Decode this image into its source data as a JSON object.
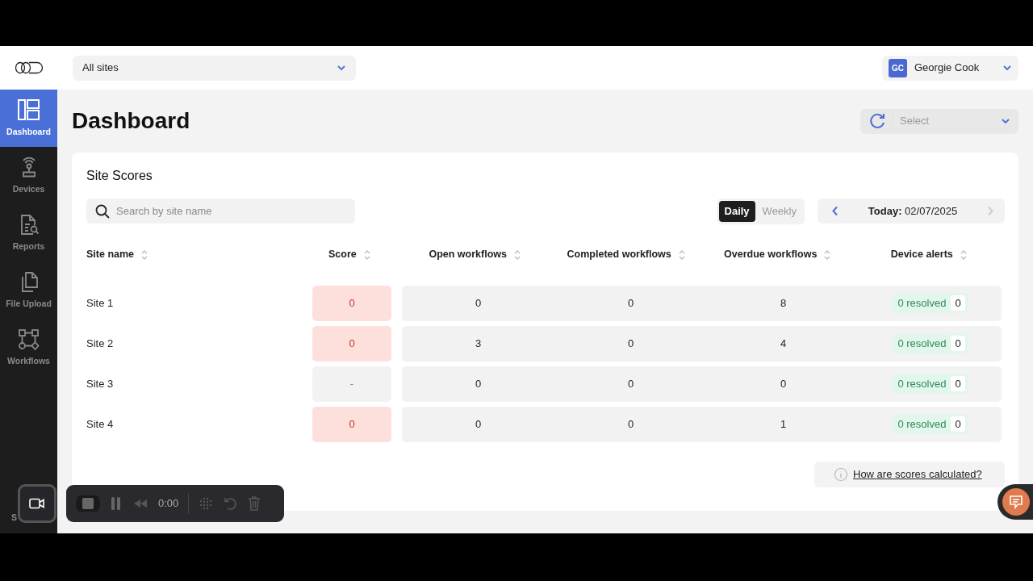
{
  "header": {
    "site_filter": "All sites",
    "user": {
      "initials": "GC",
      "name": "Georgie Cook"
    }
  },
  "sidebar": {
    "items": [
      {
        "label": "Dashboard",
        "selected": true
      },
      {
        "label": "Devices",
        "selected": false
      },
      {
        "label": "Reports",
        "selected": false
      },
      {
        "label": "File Upload",
        "selected": false
      },
      {
        "label": "Workflows",
        "selected": false
      }
    ],
    "partial_label": "S"
  },
  "page": {
    "title": "Dashboard",
    "select": {
      "placeholder": "Select"
    }
  },
  "site_scores": {
    "title": "Site Scores",
    "search": {
      "placeholder": "Search by site name"
    },
    "period_tabs": [
      {
        "label": "Daily",
        "selected": true
      },
      {
        "label": "Weekly",
        "selected": false
      }
    ],
    "date": {
      "prefix": "Today:",
      "value": "02/07/2025"
    },
    "columns": [
      "Site name",
      "Score",
      "Open workflows",
      "Completed workflows",
      "Overdue workflows",
      "Device alerts"
    ],
    "rows": [
      {
        "site": "Site 1",
        "score": "0",
        "kind": "alert",
        "open": "0",
        "completed": "0",
        "overdue": "8",
        "resolved": "0 resolved",
        "alerts": "0"
      },
      {
        "site": "Site 2",
        "score": "0",
        "kind": "alert",
        "open": "3",
        "completed": "0",
        "overdue": "4",
        "resolved": "0 resolved",
        "alerts": "0"
      },
      {
        "site": "Site 3",
        "score": "-",
        "kind": "none",
        "open": "0",
        "completed": "0",
        "overdue": "0",
        "resolved": "0 resolved",
        "alerts": "0"
      },
      {
        "site": "Site 4",
        "score": "0",
        "kind": "alert",
        "open": "0",
        "completed": "0",
        "overdue": "1",
        "resolved": "0 resolved",
        "alerts": "0"
      }
    ],
    "help_link": "How are scores calculated?"
  },
  "recorder": {
    "time": "0:00"
  }
}
